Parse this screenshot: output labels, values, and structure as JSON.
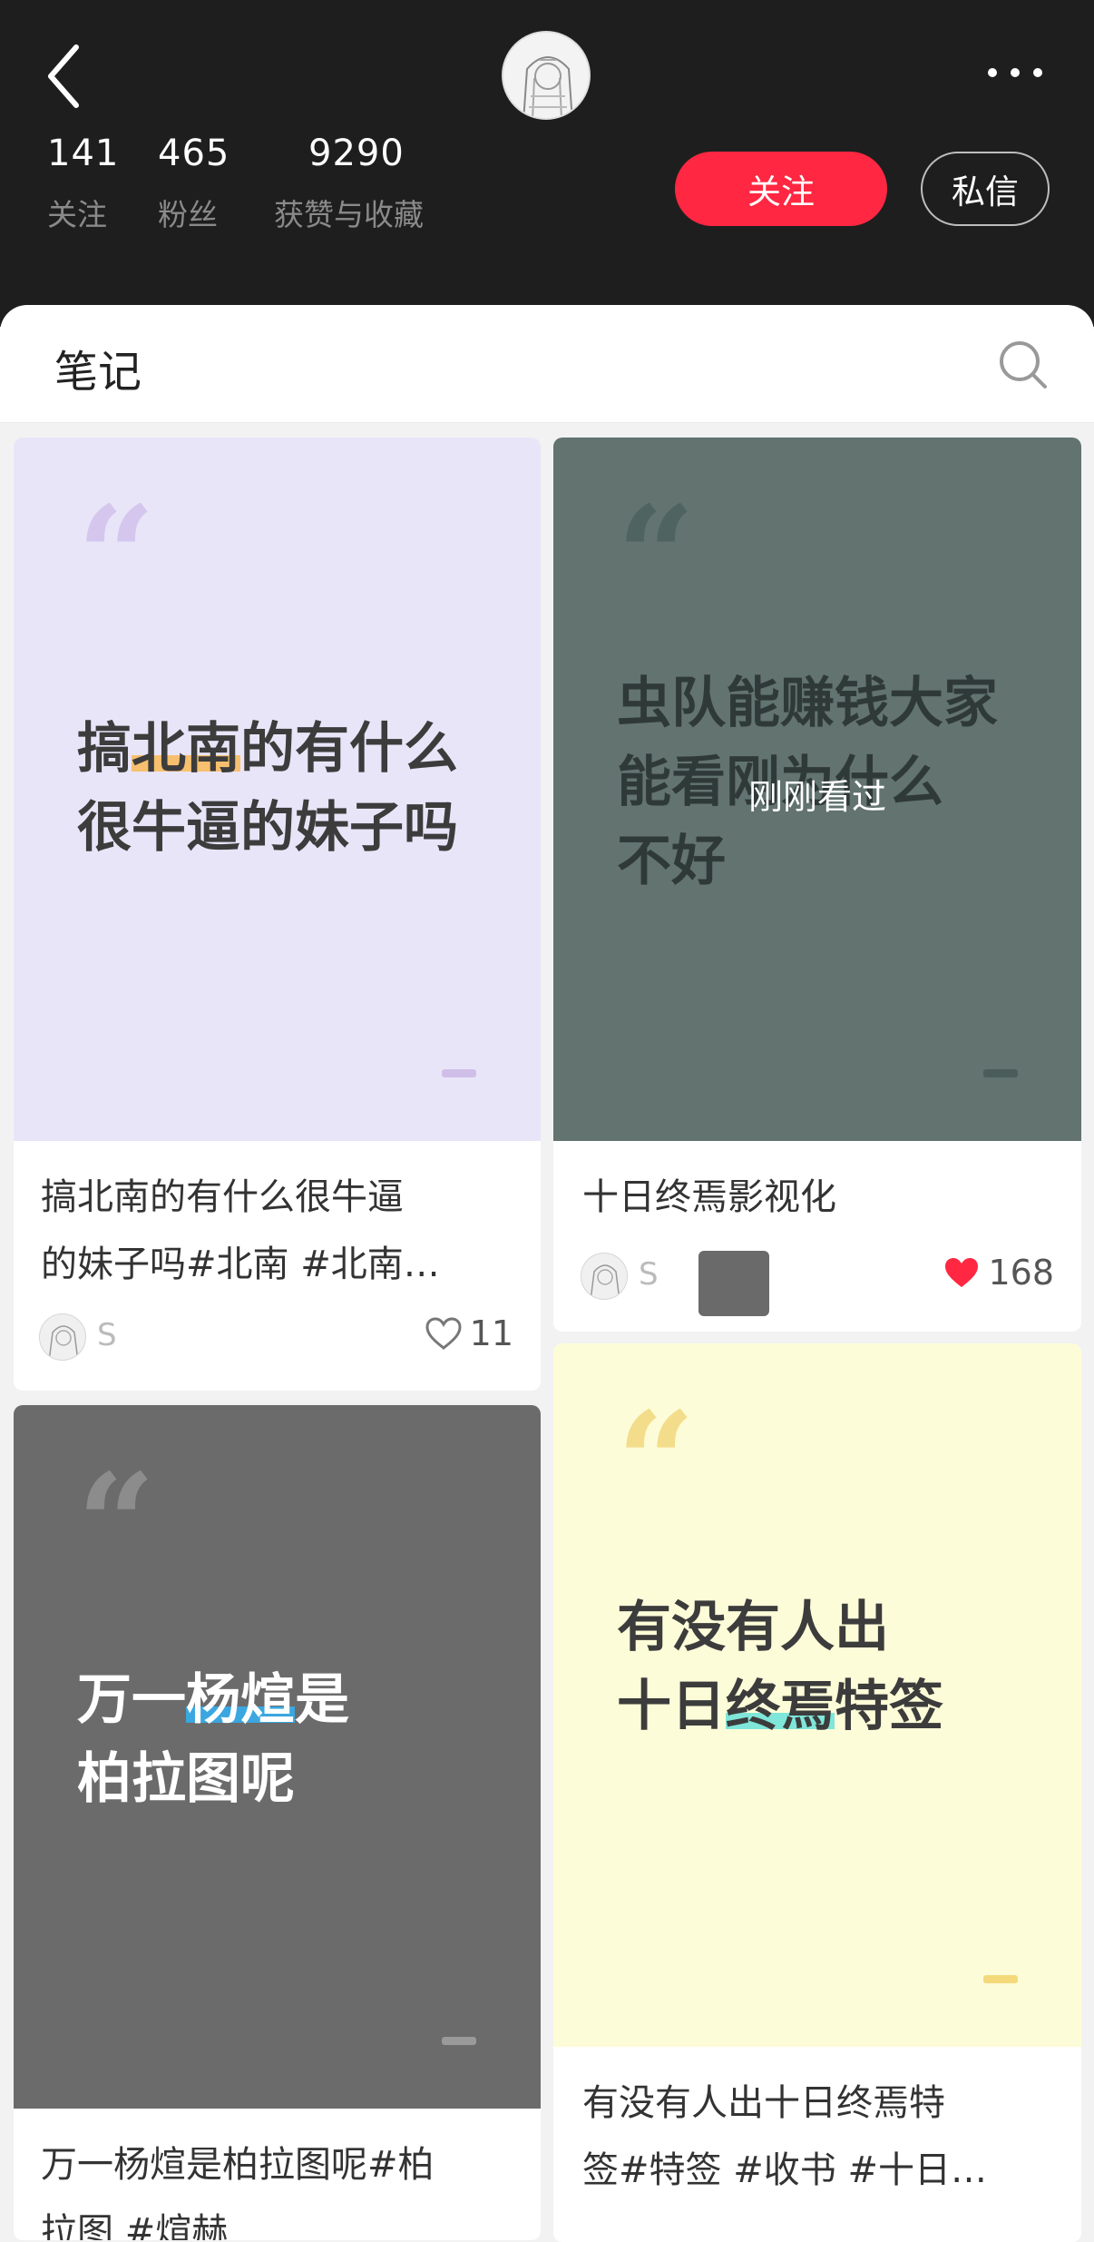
{
  "header": {
    "stats": [
      {
        "value": "141",
        "label": "关注"
      },
      {
        "value": "465",
        "label": "粉丝"
      },
      {
        "value": "9290",
        "label": "获赞与收藏"
      }
    ],
    "follow_label": "关注",
    "message_label": "私信"
  },
  "tabbar": {
    "title": "笔记"
  },
  "notes": [
    {
      "cover_lines": [
        "搞北南的有什么",
        "很牛逼的妹子吗"
      ],
      "highlight": "北南",
      "caption_lines": [
        "搞北南的有什么很牛逼",
        "的妹子吗#北南 #北南…"
      ],
      "author": "S",
      "likes": "11",
      "liked": false
    },
    {
      "cover_lines": [
        "虫队能赚钱大家",
        "能看刚为什么",
        "不好"
      ],
      "overlay": "刚刚看过",
      "caption_lines": [
        "十日终焉影视化"
      ],
      "author": "S",
      "likes": "168",
      "liked": true
    },
    {
      "cover_lines": [
        "万一杨煊是",
        "柏拉图呢"
      ],
      "highlight": "杨煊",
      "caption_lines": [
        "万一杨煊是柏拉图呢#柏",
        "拉图 #煊赫"
      ]
    },
    {
      "cover_lines": [
        "有没有人出",
        "十日终焉特签"
      ],
      "highlight": "终焉",
      "caption_lines": [
        "有没有人出十日终焉特",
        "签#特签 #收书 #十日…"
      ]
    }
  ],
  "colors": {
    "header_bg": "#1e1e1f",
    "accent": "#ff2741",
    "card1_bg": "#e9e5f9",
    "card2_bg": "#627370",
    "card3_bg": "#6b6b6b",
    "card4_bg": "#fdfcd8"
  },
  "icons": [
    "back-icon",
    "more-icon",
    "search-icon",
    "heart-outline-icon",
    "heart-filled-icon",
    "quote-icon"
  ]
}
